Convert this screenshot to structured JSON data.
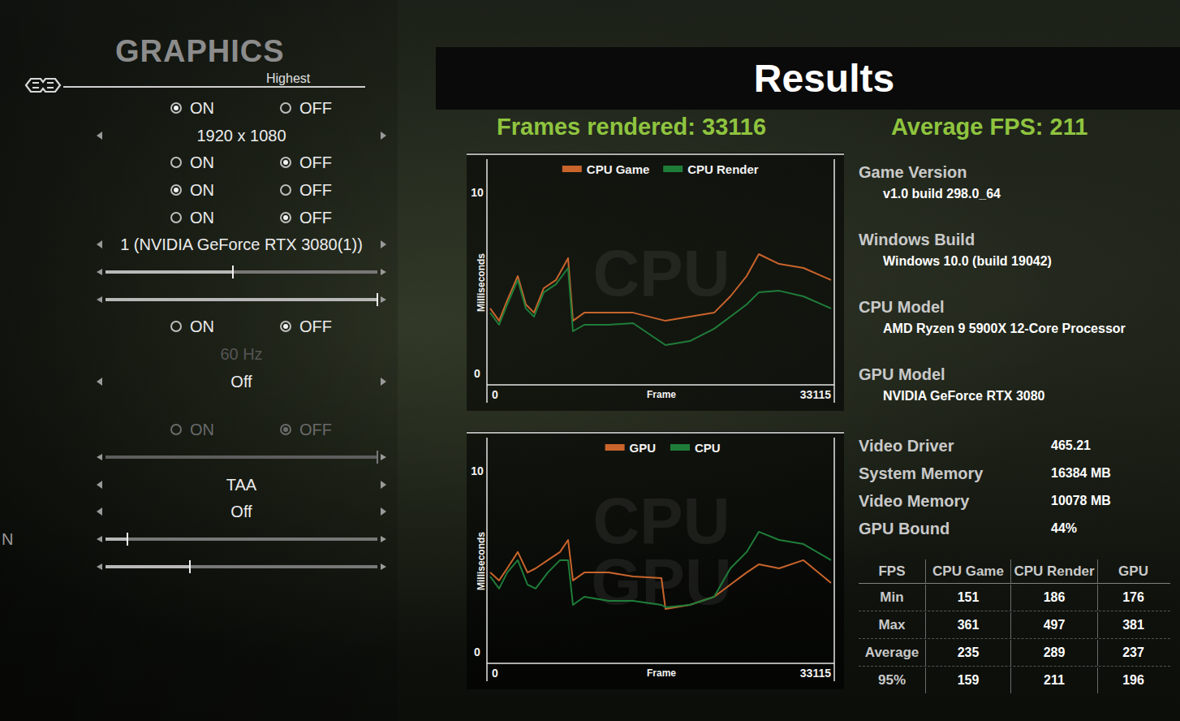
{
  "settings_panel": {
    "title": "GRAPHICS",
    "column_header": "Highest",
    "rows": [
      {
        "kind": "radio",
        "disabled": false,
        "options": [
          {
            "label": "ON",
            "selected": true
          },
          {
            "label": "OFF",
            "selected": false
          }
        ]
      },
      {
        "kind": "select",
        "disabled": false,
        "value": "1920 x 1080"
      },
      {
        "kind": "radio",
        "disabled": false,
        "options": [
          {
            "label": "ON",
            "selected": false
          },
          {
            "label": "OFF",
            "selected": true
          }
        ]
      },
      {
        "kind": "radio",
        "disabled": false,
        "options": [
          {
            "label": "ON",
            "selected": true
          },
          {
            "label": "OFF",
            "selected": false
          }
        ]
      },
      {
        "kind": "radio",
        "disabled": false,
        "options": [
          {
            "label": "ON",
            "selected": false
          },
          {
            "label": "OFF",
            "selected": true
          }
        ]
      },
      {
        "kind": "select",
        "disabled": false,
        "value": "1 (NVIDIA GeForce RTX 3080(1))"
      },
      {
        "kind": "slider",
        "disabled": false,
        "level": 0.47
      },
      {
        "kind": "slider",
        "disabled": false,
        "level": 1.0
      },
      {
        "kind": "radio",
        "disabled": false,
        "options": [
          {
            "label": "ON",
            "selected": false
          },
          {
            "label": "OFF",
            "selected": true
          }
        ]
      },
      {
        "kind": "label",
        "disabled": true,
        "value": "60 Hz"
      },
      {
        "kind": "select",
        "disabled": false,
        "value": "Off"
      },
      {
        "kind": "radio",
        "disabled": true,
        "options": [
          {
            "label": "ON",
            "selected": false
          },
          {
            "label": "OFF",
            "selected": true
          }
        ]
      },
      {
        "kind": "slider",
        "disabled": true,
        "level": 1.0
      },
      {
        "kind": "select",
        "disabled": false,
        "value": "TAA"
      },
      {
        "kind": "select",
        "disabled": false,
        "value": "Off"
      },
      {
        "kind": "slider",
        "disabled": false,
        "level": 0.08,
        "side_text": "N"
      },
      {
        "kind": "slider",
        "disabled": false,
        "level": 0.31
      }
    ]
  },
  "results": {
    "title": "Results",
    "frames_rendered": "Frames rendered: 33116",
    "average_fps": "Average FPS: 211",
    "charts": [
      {
        "watermark": [
          "CPU"
        ],
        "y_ticks": [
          "10",
          "0"
        ],
        "y_label": "Milliseconds",
        "x_ticks": [
          "0",
          "33115"
        ],
        "x_label": "Frame",
        "frames": [
          0,
          867,
          1656,
          2681,
          3469,
          4258,
          5204,
          6387,
          7570,
          8043,
          9147,
          11512,
          13878,
          17032,
          19398,
          21763,
          23340,
          24917,
          26100,
          28071,
          30437,
          33115
        ],
        "series": [
          {
            "name": "CPU Game",
            "color": "#c8642c",
            "values": [
              3.59,
              2.91,
              4.04,
              5.38,
              3.81,
              3.36,
              4.71,
              5.16,
              6.37,
              2.91,
              3.36,
              3.36,
              3.36,
              2.91,
              3.14,
              3.36,
              4.26,
              5.38,
              6.59,
              6.05,
              5.83,
              5.16
            ]
          },
          {
            "name": "CPU Render",
            "color": "#1f7d3a",
            "values": [
              3.36,
              2.69,
              3.81,
              5.16,
              3.59,
              3.14,
              4.48,
              4.93,
              5.83,
              2.33,
              2.69,
              2.69,
              2.78,
              1.57,
              1.79,
              2.47,
              3.14,
              3.81,
              4.48,
              4.57,
              4.26,
              3.59
            ]
          }
        ]
      },
      {
        "watermark": [
          "CPU",
          "GPU"
        ],
        "y_ticks": [
          "10",
          "0"
        ],
        "y_label": "Milliseconds",
        "x_ticks": [
          "0",
          "33115"
        ],
        "x_label": "Frame",
        "frames": [
          0,
          867,
          1656,
          2681,
          3627,
          4416,
          5598,
          6781,
          7570,
          8043,
          9147,
          11512,
          13878,
          16637,
          17032,
          19398,
          21763,
          23340,
          24917,
          26100,
          28071,
          30437,
          33115
        ],
        "series": [
          {
            "name": "GPU",
            "color": "#c8642c",
            "values": [
              4.39,
              3.95,
              4.62,
              5.52,
              4.39,
              4.62,
              5.07,
              5.52,
              6.19,
              3.95,
              4.39,
              4.39,
              4.17,
              4.08,
              2.38,
              2.6,
              3.05,
              3.72,
              4.39,
              4.84,
              4.62,
              5.07,
              3.81
            ]
          },
          {
            "name": "CPU",
            "color": "#1f7d3a",
            "values": [
              4.17,
              3.5,
              4.39,
              5.07,
              3.72,
              3.5,
              4.39,
              5.07,
              5.07,
              2.6,
              3.05,
              2.83,
              2.83,
              2.6,
              2.47,
              2.6,
              3.05,
              4.62,
              5.52,
              6.64,
              6.19,
              5.96,
              5.07
            ]
          }
        ]
      }
    ],
    "system_info": [
      {
        "label": "Game Version",
        "value": "v1.0 build 298.0_64"
      },
      {
        "label": "Windows Build",
        "value": "Windows 10.0 (build 19042)"
      },
      {
        "label": "CPU Model",
        "value": "AMD Ryzen 9 5900X 12-Core Processor"
      },
      {
        "label": "GPU Model",
        "value": "NVIDIA GeForce RTX 3080"
      }
    ],
    "stats": [
      {
        "label": "Video Driver",
        "value": "465.21"
      },
      {
        "label": "System Memory",
        "value": "16384 MB"
      },
      {
        "label": "Video Memory",
        "value": "10078 MB"
      },
      {
        "label": "GPU Bound",
        "value": "44%"
      }
    ],
    "fps_table": {
      "columns": [
        "FPS",
        "CPU Game",
        "CPU Render",
        "GPU"
      ],
      "rows": [
        [
          "Min",
          "151",
          "186",
          "176"
        ],
        [
          "Max",
          "361",
          "497",
          "381"
        ],
        [
          "Average",
          "235",
          "289",
          "237"
        ],
        [
          "95%",
          "159",
          "211",
          "196"
        ]
      ]
    }
  }
}
